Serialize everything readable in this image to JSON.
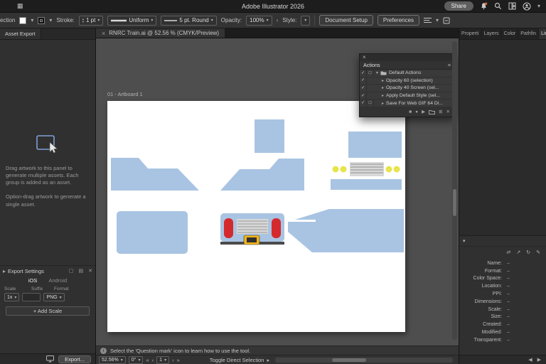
{
  "colors": {
    "train_blue": "#a9c4e2",
    "train_red": "#d42a2e",
    "train_yellow": "#e8e44c",
    "badge_yellow": "#f0b41e",
    "grille_gray": "#d8d8d8",
    "accent_blue": "#4aa2f5"
  },
  "icons": {
    "menu": "▦",
    "close": "×",
    "chevron_down": "▾",
    "chevron_up": "▴",
    "chevron_right": "▸",
    "chevron_small_right": "›",
    "panel_menu": "≡",
    "info": "i",
    "check": "✓",
    "dialog_box": "□",
    "stop": "■",
    "record": "●",
    "play": "▶",
    "new_action": "⊞",
    "delete": "✕",
    "duplicate": "▢",
    "list": "▤",
    "relink": "⇄",
    "goto_link": "↗",
    "update_link": "↻",
    "edit_original": "✎",
    "arrow_left": "◀",
    "arrow_right": "▶",
    "nav_first": "«",
    "nav_prev": "‹",
    "nav_next": "›",
    "nav_last": "»"
  },
  "titlebar": {
    "title": "Adobe Illustrator 2026",
    "share": "Share"
  },
  "controlbar": {
    "selection": "ection",
    "stroke_label": "Stroke:",
    "stroke_value": "1 pt",
    "width_profile": "Uniform",
    "brush": "5 pt. Round",
    "opacity_label": "Opacity:",
    "opacity_value": "100%",
    "style_label": "Style:",
    "document_setup": "Document Setup",
    "preferences": "Preferences"
  },
  "document_tab": {
    "title": "RNRC Train.ai @ 52.56 % (CMYK/Preview)"
  },
  "asset_export": {
    "title": "Asset Export",
    "hint_primary": "Drag artwork to this panel to generate multiple assets. Each group is added as an asset.",
    "hint_secondary": "Option-drag artwork to generate a single asset.",
    "settings_title": "Export Settings",
    "platform_ios": "iOS",
    "platform_android": "Android",
    "col_scale": "Scale",
    "col_suffix": "Suffix",
    "col_format": "Format",
    "scale_value": "1x",
    "suffix_value": "",
    "format_value": "PNG",
    "add_scale": "+ Add Scale",
    "export_button": "Export..."
  },
  "canvas": {
    "artboard_label": "01 - Artboard 1"
  },
  "actions_panel": {
    "title": "Actions",
    "rows": [
      {
        "label": "Default Actions"
      },
      {
        "label": "Opacity 60 (selection)"
      },
      {
        "label": "Opacity 40 Screen (sel..."
      },
      {
        "label": "Apply Default Style (sel..."
      },
      {
        "label": "Save For Web GIF 64 Di..."
      }
    ]
  },
  "right_panel": {
    "tabs": [
      "Properti",
      "Layers",
      "Color",
      "Pathfin",
      "Links"
    ],
    "properties": [
      {
        "label": "Name:",
        "value": "–"
      },
      {
        "label": "Format:",
        "value": "–"
      },
      {
        "label": "Color Space:",
        "value": "–"
      },
      {
        "label": "Location:",
        "value": "–"
      },
      {
        "label": "PPI:",
        "value": "–"
      },
      {
        "label": "Dimensions:",
        "value": "–"
      },
      {
        "label": "Scale:",
        "value": "–"
      },
      {
        "label": "Size:",
        "value": "–"
      },
      {
        "label": "Created:",
        "value": "–"
      },
      {
        "label": "Modified:",
        "value": "–"
      },
      {
        "label": "Transparent:",
        "value": "–"
      }
    ]
  },
  "statusbar": {
    "hint": "Select the 'Question mark' icon to learn how to use the tool.",
    "zoom": "52.56%",
    "rotation": "0°",
    "artboard_number": "1",
    "tool": "Toggle Direct Selection"
  }
}
